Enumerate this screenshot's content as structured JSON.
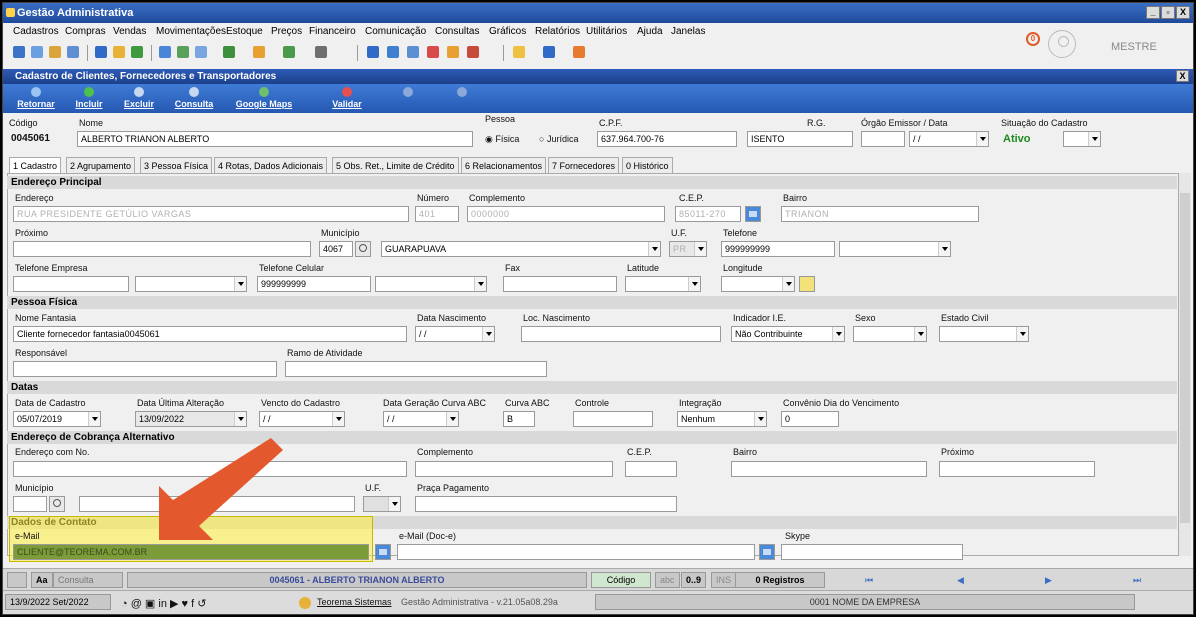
{
  "window": {
    "title": "Gestão Administrativa",
    "min": "_",
    "max": "▫",
    "close": "X"
  },
  "menu": [
    "Cadastros",
    "Compras",
    "Vendas",
    "Movimentações",
    "Estoque",
    "Preços",
    "Financeiro",
    "Comunicação",
    "Consultas",
    "Gráficos",
    "Relatórios",
    "Utilitários",
    "Ajuda",
    "Janelas"
  ],
  "user": {
    "name": "MESTRE",
    "badge": "0"
  },
  "form": {
    "title": "Cadastro de Clientes, Fornecedores e Transportadores",
    "close": "X",
    "actions": [
      {
        "label": "Retornar",
        "enabled": true
      },
      {
        "label": "Incluir",
        "enabled": true
      },
      {
        "label": "Excluir",
        "enabled": true
      },
      {
        "label": "Consulta",
        "enabled": true
      },
      {
        "label": "Google Maps",
        "enabled": true
      },
      {
        "label": "Validar",
        "enabled": true
      }
    ],
    "header": {
      "codigo_label": "Código",
      "codigo": "0045061",
      "nome_label": "Nome",
      "nome": "ALBERTO TRIANON ALBERTO",
      "pessoa_label": "Pessoa",
      "fisica": "Física",
      "juridica": "Jurídica",
      "cpf_label": "C.P.F.",
      "cpf": "637.964.700-76",
      "rg_label": "R.G.",
      "rg": "ISENTO",
      "orgao_label": "Órgão Emissor  / Data",
      "orgao_data": "/ /",
      "situacao_label": "Situação do Cadastro",
      "situacao": "Ativo"
    },
    "tabs": [
      "1 Cadastro",
      "2 Agrupamento",
      "3 Pessoa Física",
      "4 Rotas, Dados Adicionais",
      "5 Obs. Ret., Limite de Crédito",
      "6 Relacionamentos",
      "7 Fornecedores",
      "0 Histórico"
    ],
    "endereco": {
      "section": "Endereço Principal",
      "endereco_label": "Endereço",
      "endereco": "RUA PRESIDENTE GETÚLIO VARGAS",
      "numero_label": "Número",
      "numero": "401",
      "complemento_label": "Complemento",
      "complemento": "0000000",
      "cep_label": "C.E.P.",
      "cep": "85011-270",
      "bairro_label": "Bairro",
      "bairro": "TRIANON",
      "proximo_label": "Próximo",
      "municipio_label": "Município",
      "municipio_cod": "4067",
      "municipio": "GUARAPUAVA",
      "uf_label": "U.F.",
      "uf": "PR",
      "telefone_label": "Telefone",
      "telefone": "999999999",
      "tel_empresa_label": "Telefone Empresa",
      "tel_celular_label": "Telefone Celular",
      "tel_celular": "999999999",
      "fax_label": "Fax",
      "latitude_label": "Latitude",
      "longitude_label": "Longitude"
    },
    "pessoa_fisica": {
      "section": "Pessoa Física",
      "fantasia_label": "Nome Fantasia",
      "fantasia": "Cliente fornecedor fantasia0045061",
      "nascimento_label": "Data Nascimento",
      "nascimento": "/ /",
      "loc_nasc_label": "Loc. Nascimento",
      "indicador_label": "Indicador I.E.",
      "indicador": "Não Contribuinte",
      "sexo_label": "Sexo",
      "estado_civil_label": "Estado Civil",
      "responsavel_label": "Responsável",
      "ramo_label": "Ramo de Atividade"
    },
    "datas": {
      "section": "Datas",
      "cadastro_label": "Data de Cadastro",
      "cadastro": "05/07/2019",
      "ult_alt_label": "Data Última Alteração",
      "ult_alt": "13/09/2022",
      "vencto_label": "Vencto do Cadastro",
      "vencto": "/ /",
      "curva_data_label": "Data Geração Curva ABC",
      "curva_data": "/ /",
      "curva_label": "Curva ABC",
      "curva": "B",
      "controle_label": "Controle",
      "integracao_label": "Integração",
      "integracao": "Nenhum",
      "convenio_label": "Convênio Dia do Vencimento",
      "convenio": "0"
    },
    "cobranca": {
      "section": "Endereço de Cobrança Alternativo",
      "endereco_label": "Endereço com No.",
      "complemento_label": "Complemento",
      "cep_label": "C.E.P.",
      "bairro_label": "Bairro",
      "proximo_label": "Próximo",
      "municipio_label": "Município",
      "uf_label": "U.F.",
      "praca_label": "Praça Pagamento"
    },
    "contato": {
      "section": "Dados de Contato",
      "email_label": "e-Mail",
      "email": "CLIENTE@TEOREMA.COM.BR",
      "email_doc_label": "e-Mail (Doc-e)",
      "skype_label": "Skype"
    }
  },
  "navbar": {
    "aa": "Aa",
    "consulta": "Consulta",
    "record": "0045061 - ALBERTO TRIANON ALBERTO",
    "codigo": "Código",
    "abc": "abc",
    "zero_nine": "0..9",
    "ins": "INS",
    "registros": "0 Registros"
  },
  "footer": {
    "date": "13/9/2022 Set/2022",
    "company": "Teorema Sistemas",
    "version": "Gestão Administrativa - v.21.05a08.29a",
    "empresa": "0001 NOME DA EMPRESA"
  },
  "colors": {
    "titlebar": "#1f4a9b",
    "actionbar": "#2f6ac6",
    "highlight": "#fff03c",
    "arrow": "#e4582e",
    "active": "#1f8a1f"
  }
}
